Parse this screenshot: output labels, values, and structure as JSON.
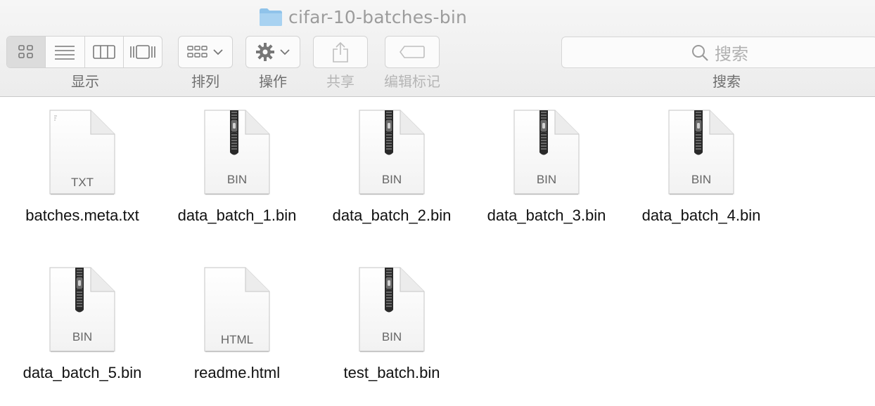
{
  "window": {
    "title": "cifar-10-batches-bin"
  },
  "toolbar": {
    "view_label": "显示",
    "arrange_label": "排列",
    "action_label": "操作",
    "share_label": "共享",
    "tags_label": "编辑标记",
    "search_label": "搜索",
    "search_placeholder": "搜索"
  },
  "files": [
    {
      "name": "batches.meta.txt",
      "ext": "TXT",
      "kind": "text-document"
    },
    {
      "name": "data_batch_1.bin",
      "ext": "BIN",
      "kind": "archive"
    },
    {
      "name": "data_batch_2.bin",
      "ext": "BIN",
      "kind": "archive"
    },
    {
      "name": "data_batch_3.bin",
      "ext": "BIN",
      "kind": "archive"
    },
    {
      "name": "data_batch_4.bin",
      "ext": "BIN",
      "kind": "archive"
    },
    {
      "name": "data_batch_5.bin",
      "ext": "BIN",
      "kind": "archive"
    },
    {
      "name": "readme.html",
      "ext": "HTML",
      "kind": "document"
    },
    {
      "name": "test_batch.bin",
      "ext": "BIN",
      "kind": "archive"
    }
  ],
  "colors": {
    "folder_blue": "#8fc3ea",
    "toolbar_text": "#6e6e6e",
    "disabled_text": "#b5b5b5"
  }
}
